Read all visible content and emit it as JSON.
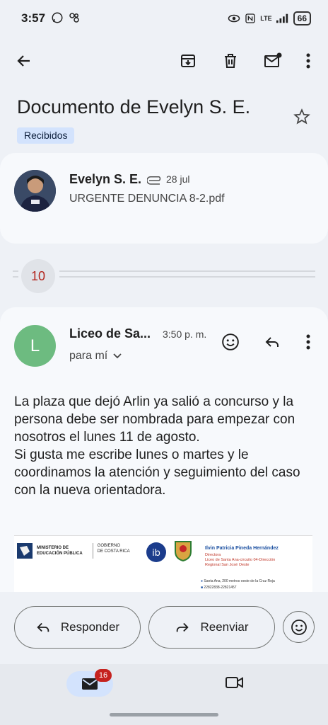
{
  "status_bar": {
    "time": "3:57",
    "battery": "66",
    "network": "LTE"
  },
  "email": {
    "subject": "Documento de Evelyn S. E.",
    "label": "Recibidos"
  },
  "thread": {
    "first_message": {
      "sender": "Evelyn S. E.",
      "date": "28 jul",
      "snippet": "URGENTE DENUNCIA 8-2.pdf"
    },
    "collapsed_count": "10",
    "open_message": {
      "avatar_letter": "L",
      "sender": "Liceo de Sa...",
      "time": "3:50 p. m.",
      "to": "para mí",
      "body": [
        "La plaza que dejó Arlin ya salió a concurso y la persona debe ser nombrada para empezar con nosotros el lunes 11 de agosto.",
        "Si gusta me escribe lunes o martes y le coordinamos la atención y seguimiento del caso con la nueva orientadora."
      ],
      "signature": {
        "ministry_line1": "MINISTERIO DE",
        "ministry_line2": "EDUCACIÓN PÚBLICA",
        "gov_line1": "GOBIERNO",
        "gov_line2": "DE COSTA RICA",
        "name": "Ilvin Patricia Pineda Hernández",
        "role": "Directora",
        "school": "Liceo de Santa Ana-circuito 04-Dirección",
        "region": "Regional San José Oeste",
        "address": "Santa Ana, 200 metros oeste de la Cruz Roja",
        "phone": "22822838-22821457"
      }
    }
  },
  "actions": {
    "reply_label": "Responder",
    "forward_label": "Reenviar"
  },
  "bottom_nav": {
    "mail_badge": "16"
  },
  "colors": {
    "accent_chip": "#d3e3fd",
    "avatar_green": "#6dbb80",
    "badge_red": "#c5221f",
    "count_red": "#b3261e"
  }
}
